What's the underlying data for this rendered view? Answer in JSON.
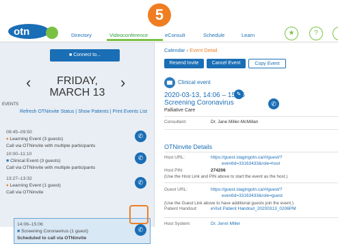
{
  "step_badge": "5",
  "nav": [
    "Directory",
    "Videoconference",
    "eConsult",
    "Schedule",
    "Learn"
  ],
  "left": {
    "connect_label": "Connect to...",
    "date_line1": "FRIDAY,",
    "date_line2": "MARCH 13",
    "events_header": "EVENTS",
    "links": "Refresh OTNinvite Status | Show Patients | Print Events List",
    "events": [
      {
        "time": "09:45–09:50",
        "title": "Learning Event (3 guests)",
        "sub": "Call via OTNinvite with multiple participants"
      },
      {
        "time": "10:00–11:10",
        "title": "Clinical Event (3 guests)",
        "sub": "Call via OTNinvite with multiple participants"
      },
      {
        "time": "13:27–13:32",
        "title": "Learning Event (1 guest)",
        "sub": "Call via OTNinvite"
      },
      {
        "time": "14:06–15:06",
        "title": "Screening Coronavirus (1 guest)",
        "sub": "Scheduled to call via OTNinvite"
      }
    ]
  },
  "right": {
    "crumb_root": "Calendar",
    "crumb_current": "Event Detail",
    "btn_resend": "Resend Invite",
    "btn_cancel": "Cancel Event",
    "btn_copy": "Copy Event",
    "event_type": "Clinical event",
    "event_time": "2020-03-13, 14:06 – 15:06",
    "event_title": "Screening Coronavirus",
    "event_sub": "Palliative Care",
    "consultant_label": "Consultant:",
    "consultant_value": "Dr. Jane Miller-McMillan",
    "section_title": "OTNinvite Details",
    "host_url_label": "Host URL:",
    "host_url_line1": "https://guest.stagingotn.ca/#/guest/?",
    "host_url_line2": "eventId=33163433&role=host",
    "host_pin_label": "Host PIN:",
    "host_pin_value": "274206",
    "host_note": "(Use the Host Link and PIN above to start the event as the host.)",
    "guest_url_label": "Guest URL:",
    "guest_url_line1": "https://guest.stagingotn.ca/#/guest/?",
    "guest_url_line2": "eventId=33163433&role=guest",
    "guest_note": "(Use the Guest Link above to have additional guests join the event.)",
    "handout_label": "Patient Handout:",
    "handout_value": "eVisit Patient Handout_20200313_0206PM",
    "host_system_label": "Host System:",
    "host_system_value": "Dr. Jenni Miller"
  }
}
